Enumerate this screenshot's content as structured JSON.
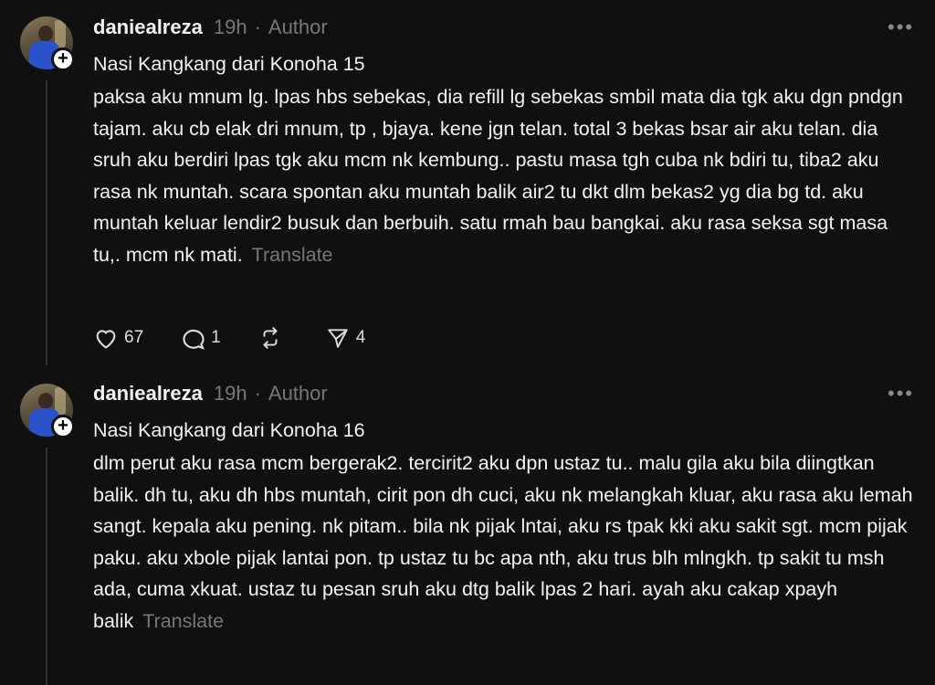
{
  "posts": [
    {
      "username": "daniealreza",
      "time": "19h",
      "role": "Author",
      "title": "Nasi Kangkang dari Konoha 15",
      "body": "paksa aku mnum lg. lpas hbs sebekas, dia refill lg sebekas smbil mata dia tgk aku dgn pndgn tajam. aku cb elak dri mnum, tp , bjaya. kene jgn telan. total 3 bekas bsar air aku telan. dia sruh aku berdiri lpas tgk aku mcm nk kembung.. pastu masa tgh cuba nk bdiri tu, tiba2 aku rasa nk muntah. scara spontan aku muntah balik air2 tu dkt dlm bekas2 yg dia bg td. aku muntah keluar lendir2 busuk dan berbuih. satu rmah bau bangkai. aku rasa seksa sgt masa tu,. mcm nk mati.",
      "translate": "Translate",
      "likes": "67",
      "replies": "1",
      "shares": "4"
    },
    {
      "username": "daniealreza",
      "time": "19h",
      "role": "Author",
      "title": "Nasi Kangkang dari Konoha 16",
      "body": "dlm perut aku rasa mcm bergerak2. tercirit2 aku dpn ustaz tu.. malu gila aku bila diingtkan balik. dh tu, aku dh hbs muntah, cirit pon dh cuci, aku nk melangkah kluar, aku rasa aku lemah sangt. kepala aku pening. nk pitam.. bila nk pijak lntai, aku rs tpak kki aku sakit sgt. mcm pijak paku. aku xbole pijak lantai pon. tp ustaz tu bc apa nth, aku trus blh mlngkh. tp sakit tu msh ada, cuma xkuat. ustaz tu pesan sruh aku dtg balik lpas 2 hari. ayah aku cakap xpayh balik",
      "translate": "Translate"
    }
  ],
  "icons": {
    "more": "more-icon",
    "like": "heart-icon",
    "reply": "comment-icon",
    "repost": "repost-icon",
    "share": "send-icon"
  },
  "colors": {
    "background": "#101010",
    "text": "#f3f3f3",
    "muted": "#777777"
  }
}
